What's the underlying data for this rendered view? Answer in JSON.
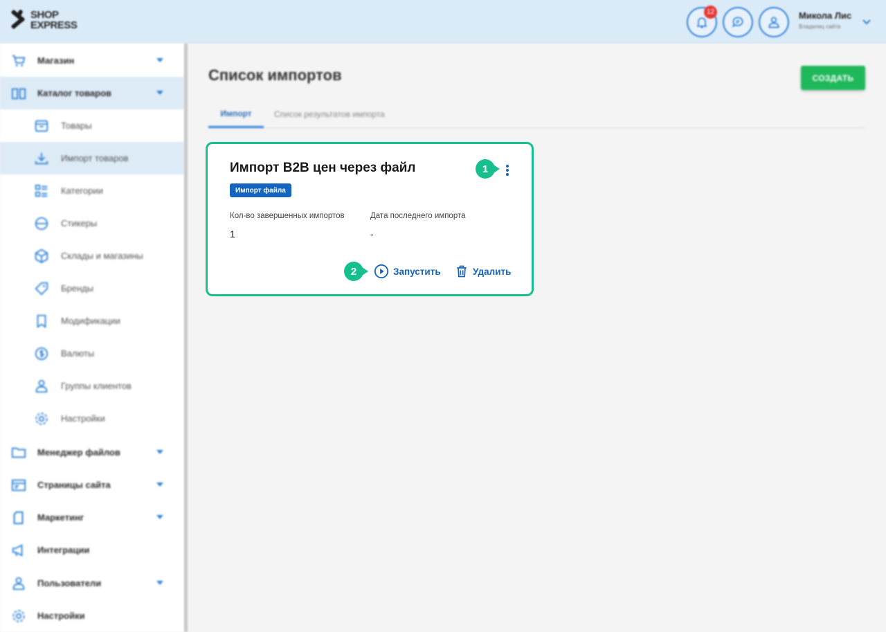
{
  "header": {
    "logo_line1": "SHOP",
    "logo_line2": "EXPRESS",
    "notifications_count": "12",
    "user_name": "Микола Лис",
    "user_role": "Владелец сайта"
  },
  "sidebar": {
    "items": [
      {
        "label": "Магазин",
        "icon": "cart-icon"
      },
      {
        "label": "Каталог товаров",
        "icon": "book-icon"
      },
      {
        "label": "Товары",
        "icon": "box-icon"
      },
      {
        "label": "Импорт товаров",
        "icon": "download-icon"
      },
      {
        "label": "Категории",
        "icon": "list-icon"
      },
      {
        "label": "Стикеры",
        "icon": "sticker-icon"
      },
      {
        "label": "Склады и магазины",
        "icon": "warehouse-icon"
      },
      {
        "label": "Бренды",
        "icon": "tag-icon"
      },
      {
        "label": "Модификации",
        "icon": "bookmark-icon"
      },
      {
        "label": "Валюты",
        "icon": "dollar-icon"
      },
      {
        "label": "Группы клиентов",
        "icon": "user-group-icon"
      },
      {
        "label": "Настройки",
        "icon": "gear-icon"
      },
      {
        "label": "Менеджер файлов",
        "icon": "folder-icon"
      },
      {
        "label": "Страницы сайта",
        "icon": "page-icon"
      },
      {
        "label": "Маркетинг",
        "icon": "marketing-icon"
      },
      {
        "label": "Интеграции",
        "icon": "megaphone-icon"
      },
      {
        "label": "Пользователи",
        "icon": "users-icon"
      },
      {
        "label": "Настройки",
        "icon": "gear-icon"
      }
    ]
  },
  "main": {
    "title": "Список импортов",
    "create_label": "СОЗДАТЬ",
    "tabs": [
      {
        "label": "Импорт"
      },
      {
        "label": "Список результатов импорта"
      }
    ]
  },
  "card": {
    "title": "Импорт B2B цен через файл",
    "badge": "Импорт файла",
    "completed_label": "Кол-во завершенных импортов",
    "completed_value": "1",
    "last_date_label": "Дата последнего импорта",
    "last_date_value": "-",
    "run_label": "Запустить",
    "delete_label": "Удалить"
  },
  "markers": {
    "m1": "1",
    "m2": "2"
  },
  "colors": {
    "topbar": "#dbeaf7",
    "accent_blue": "#1565c0",
    "create_green": "#1fb85a",
    "highlight_green": "#16c08e"
  }
}
